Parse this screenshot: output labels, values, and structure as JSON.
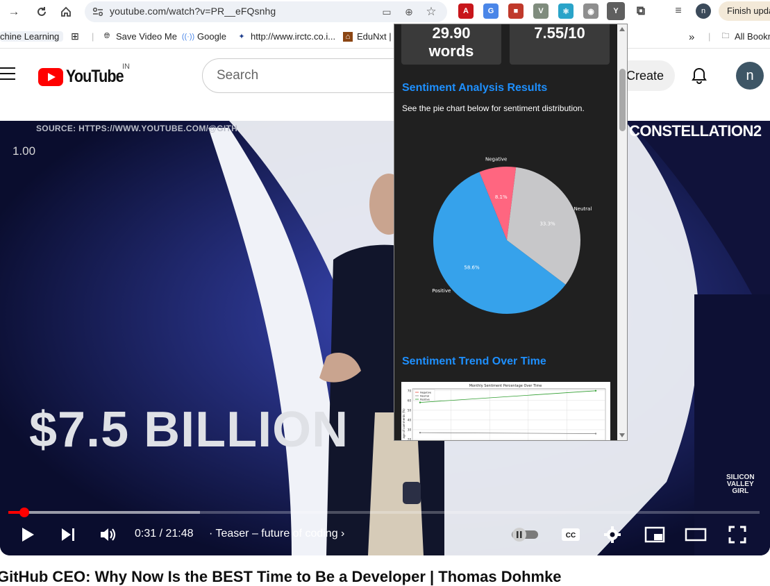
{
  "browser": {
    "url": "youtube.com/watch?v=PR__eFQsnhg",
    "profile_initial": "n",
    "finish_update_label": "Finish update",
    "bookmarks": [
      "chine Learning",
      "Save Video Me",
      "Google",
      "http://www.irctc.co.i...",
      "EduNxt |",
      "All Bookmarks"
    ],
    "bookmarks_overflow": "»"
  },
  "youtube": {
    "logo_text": "YouTube",
    "region": "IN",
    "search_placeholder": "Search",
    "create_label": "Create",
    "avatar_initial": "n"
  },
  "video": {
    "source_text": "SOURCE: HTTPS://WWW.YOUTUBE.COM/@GITH",
    "speed_label": "1.00",
    "brand_text": "CONSTELLATION2",
    "headline_overlay": "$7.5 BILLION",
    "watermark": [
      "SILICON",
      "VALLEY",
      "GIRL"
    ],
    "time_current": "0:31",
    "time_total": "21:48",
    "chapter": "Teaser – future of coding",
    "progress": 0.024,
    "title": "GitHub CEO: Why Now Is the BEST Time to Be a Developer | Thomas Dohmke"
  },
  "extension": {
    "stat_cards": [
      {
        "value": "29.90",
        "unit": "words"
      },
      {
        "value": "7.55/10",
        "unit": ""
      }
    ],
    "sentiment_title": "Sentiment Analysis Results",
    "sentiment_desc": "See the pie chart below for sentiment distribution.",
    "trend_title": "Sentiment Trend Over Time",
    "trend_chart_title": "Monthly Sentiment Percentage Over Time",
    "trend_ylabel": "age of comments (%)",
    "trend_legend": [
      "Negative",
      "Neutral",
      "Positive"
    ]
  },
  "chart_data": [
    {
      "type": "pie",
      "categories": [
        "Negative",
        "Neutral",
        "Positive"
      ],
      "values": [
        8.1,
        33.3,
        58.6
      ],
      "labels": [
        "8.1%",
        "33.3%",
        "58.6%"
      ],
      "colors": [
        "#ff6680",
        "#c7c7c9",
        "#36a2eb"
      ]
    },
    {
      "type": "line",
      "title": "Monthly Sentiment Percentage Over Time",
      "ylabel": "age of comments (%)",
      "series": [
        {
          "name": "Negative",
          "values": [],
          "color": "#e74c3c"
        },
        {
          "name": "Neutral",
          "values": [
            27,
            26
          ],
          "color": "#888888"
        },
        {
          "name": "Positive",
          "values": [
            58,
            70
          ],
          "color": "#2e9d2e"
        }
      ],
      "yticks": [
        20,
        30,
        40,
        50,
        60,
        70
      ]
    }
  ]
}
